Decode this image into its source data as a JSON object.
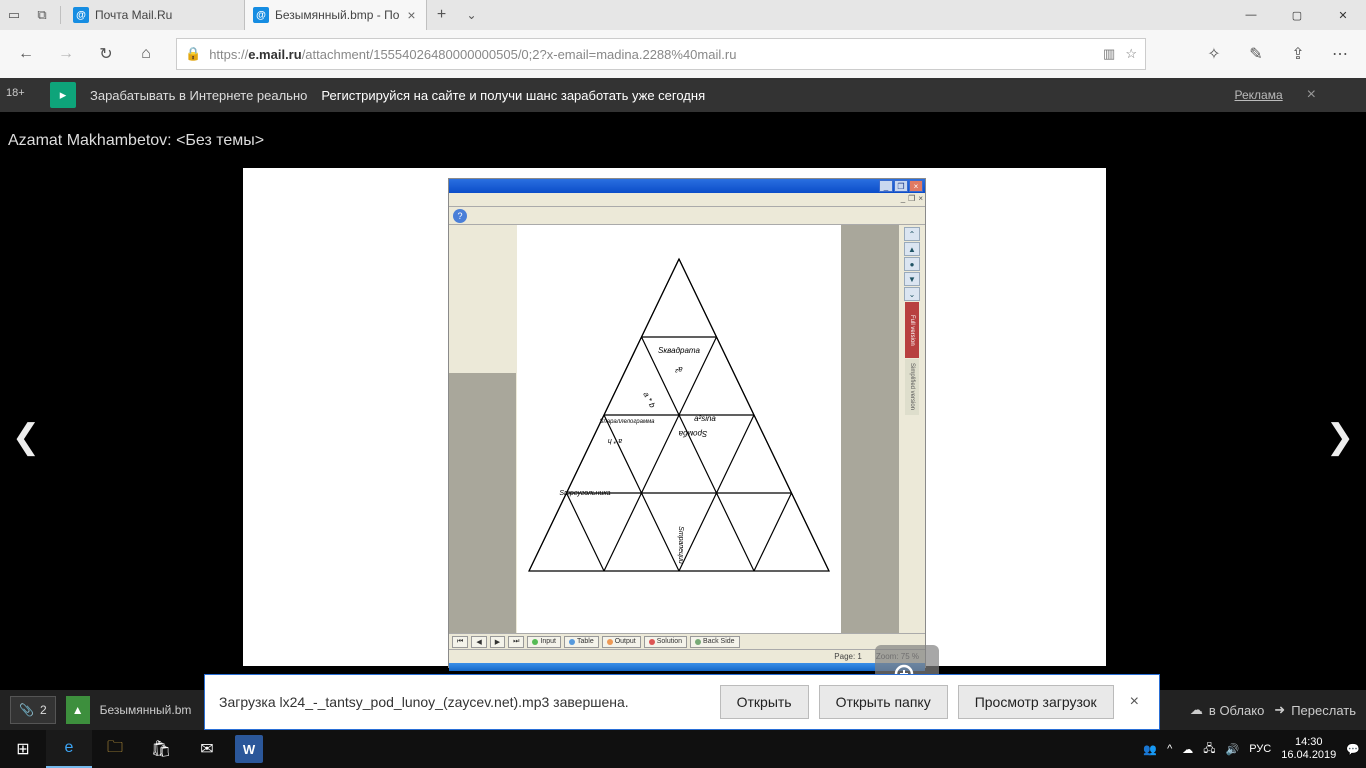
{
  "tabs": [
    {
      "label": "Почта Mail.Ru"
    },
    {
      "label": "Безымянный.bmp - По"
    }
  ],
  "url_prefix": "https://",
  "url_host": "e.mail.ru",
  "url_path": "/attachment/15554026480000000505/0;2?x-email=madina.2288%40mail.ru",
  "age_label": "18+",
  "ad": {
    "t1": "Зарабатывать в Интернете реально",
    "t2": "Регистрируйся на сайте и получи шанс заработать уже сегодня",
    "label": "Реклама"
  },
  "subject": "Azamat Makhambetov: <Без темы>",
  "inner": {
    "help": "?",
    "side_full": "Full version",
    "side_simp": "Simplified version",
    "bottom": [
      "Input",
      "Table",
      "Output",
      "Solution",
      "Back Side"
    ],
    "page": "Page: 1",
    "zoom": "Zoom: 75 %"
  },
  "triangle_labels": {
    "top": "Sквадрата",
    "a2": "a²",
    "asina": "a²sina",
    "ромба": "Sромба",
    "парал": "Sпараллелограмма",
    "треуг": "Sтреугольника",
    "ab": "a * b",
    "ah": "a * h",
    "trap": "Sтрапеции"
  },
  "dl": {
    "attach_count": "2",
    "file": "Безымянный.bm",
    "msg": "Загрузка lx24_-_tantsy_pod_lunoy_(zaycev.net).mp3 завершена.",
    "b1": "Открыть",
    "b2": "Открыть папку",
    "b3": "Просмотр загрузок",
    "cloud": "в Облако",
    "fwd": "Переслать"
  },
  "task": {
    "lang": "РУС",
    "time": "14:30",
    "date": "16.04.2019"
  }
}
